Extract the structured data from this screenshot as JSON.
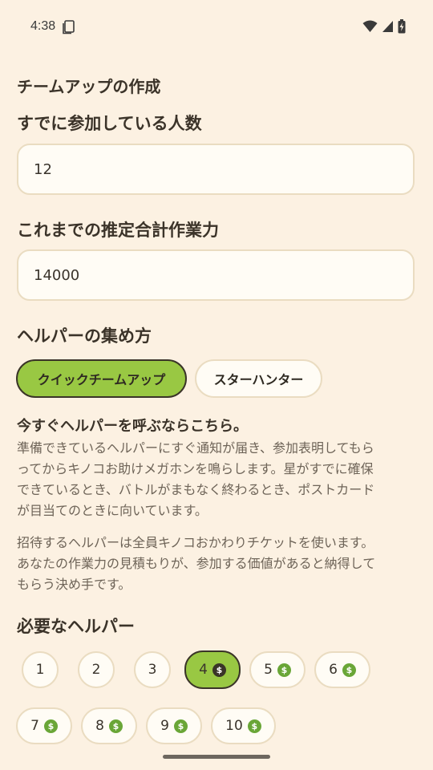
{
  "status": {
    "time": "4:38"
  },
  "page": {
    "title": "チームアップの作成",
    "joined": {
      "label": "すでに参加している人数",
      "value": "12"
    },
    "power": {
      "label": "これまでの推定合計作業力",
      "value": "14000"
    },
    "method": {
      "label": "ヘルパーの集め方",
      "options": [
        "クイックチームアップ",
        "スターハンター"
      ],
      "selected": "クイックチームアップ"
    },
    "quick": {
      "headline": "今すぐヘルパーを呼ぶならこちら。",
      "paragraph1_lines": [
        "準備できているヘルパーにすぐ通知が届き、参加表明してもら",
        "ってからキノコお助けメガホンを鳴らします。星がすでに確保",
        "できているとき、バトルがまもなく終わるとき、ポストカード",
        "が目当てのときに向いています。"
      ],
      "paragraph2_lines": [
        "招待するヘルパーは全員キノコおかわりチケットを使います。",
        "あなたの作業力の見積もりが、参加する価値があると納得して",
        "もらう決め手です。"
      ]
    },
    "helpers": {
      "label": "必要なヘルパー",
      "options": [
        {
          "num": "1",
          "coin": false
        },
        {
          "num": "2",
          "coin": false
        },
        {
          "num": "3",
          "coin": false
        },
        {
          "num": "4",
          "coin": true
        },
        {
          "num": "5",
          "coin": true
        },
        {
          "num": "6",
          "coin": true
        },
        {
          "num": "7",
          "coin": true
        },
        {
          "num": "8",
          "coin": true
        },
        {
          "num": "9",
          "coin": true
        },
        {
          "num": "10",
          "coin": true
        }
      ],
      "selected": "4"
    }
  },
  "colors": {
    "background": "#fcf1e2",
    "accent": "#99c843",
    "coin": "#6aa637"
  }
}
